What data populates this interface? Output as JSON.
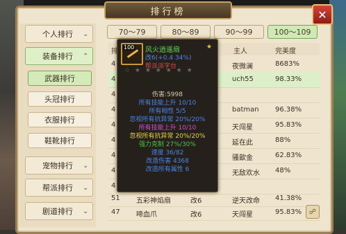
{
  "window": {
    "title": "排行榜",
    "close_label": "✕"
  },
  "sidebar": {
    "items": [
      {
        "label": "个人排行",
        "chevron": "⌄"
      },
      {
        "label": "装备排行",
        "chevron": "⌃"
      },
      {
        "label": "宠物排行",
        "chevron": "⌄"
      },
      {
        "label": "帮派排行",
        "chevron": "⌄"
      },
      {
        "label": "剧道排行",
        "chevron": "⌄"
      }
    ],
    "sub_items": [
      {
        "label": "武器排行"
      },
      {
        "label": "头冠排行"
      },
      {
        "label": "衣服排行"
      },
      {
        "label": "鞋靴排行"
      }
    ]
  },
  "range_tabs": [
    {
      "label": "70～79"
    },
    {
      "label": "80～89"
    },
    {
      "label": "90～99"
    },
    {
      "label": "100～109"
    }
  ],
  "table": {
    "headers": [
      "排",
      "主人",
      "完美度"
    ],
    "rows": [
      {
        "rank": "4",
        "owner": "夜微澜",
        "perfect": "8683%"
      },
      {
        "rank": "4",
        "owner": "uch55",
        "perfect": "98.33%"
      },
      {
        "rank": "4",
        "owner": "",
        "perfect": ""
      },
      {
        "rank": "4",
        "owner": "batman",
        "perfect": "96.38%"
      },
      {
        "rank": "4",
        "owner": "天闯星",
        "perfect": "95.83%"
      },
      {
        "rank": "4",
        "owner": "延在此",
        "perfect": "88%"
      },
      {
        "rank": "4",
        "owner": "骚歆金",
        "perfect": "62.83%"
      },
      {
        "rank": "4",
        "owner": "无敌欢水",
        "perfect": "48%"
      },
      {
        "rank": "4",
        "owner": "",
        "perfect": ""
      },
      {
        "rank": "51",
        "name": "五彩神焰扇",
        "mod": "改6",
        "owner": "逆天改命",
        "perfect": "41.38%"
      },
      {
        "rank": "47",
        "name": "啼血爪",
        "mod": "改6",
        "owner": "天闯星",
        "perfect": "95.83%"
      }
    ]
  },
  "tooltip": {
    "item_level": "100",
    "item_name": "风火逍遥扇",
    "line_mod": "改6(+0.4 34%)",
    "line_red": "帮派派字台",
    "stars": "☆ ★ ★ ★ ★ ★ ★",
    "damage": "伤害:5998",
    "stats": [
      {
        "text": "所有技能上升 10/10",
        "color": "#4a86e8"
      },
      {
        "text": "所有相性 5/5",
        "color": "#4a86e8"
      },
      {
        "text": "忽视所有抗异常 20%/20%",
        "color": "#4a86e8"
      },
      {
        "text": "所有技能上升 10/10",
        "color": "#d050d0"
      },
      {
        "text": "忽视所有抗异常 20%/20%",
        "color": "#e8d547"
      },
      {
        "text": "强力克制 27%/30%",
        "color": "#4ec24e"
      },
      {
        "text": "速度 36/82",
        "color": "#4a86e8"
      },
      {
        "text": "改造伤害 4368",
        "color": "#4a86e8"
      },
      {
        "text": "改造所有属性 6",
        "color": "#4a86e8"
      }
    ]
  },
  "footer": {
    "icon_label": "☍"
  }
}
